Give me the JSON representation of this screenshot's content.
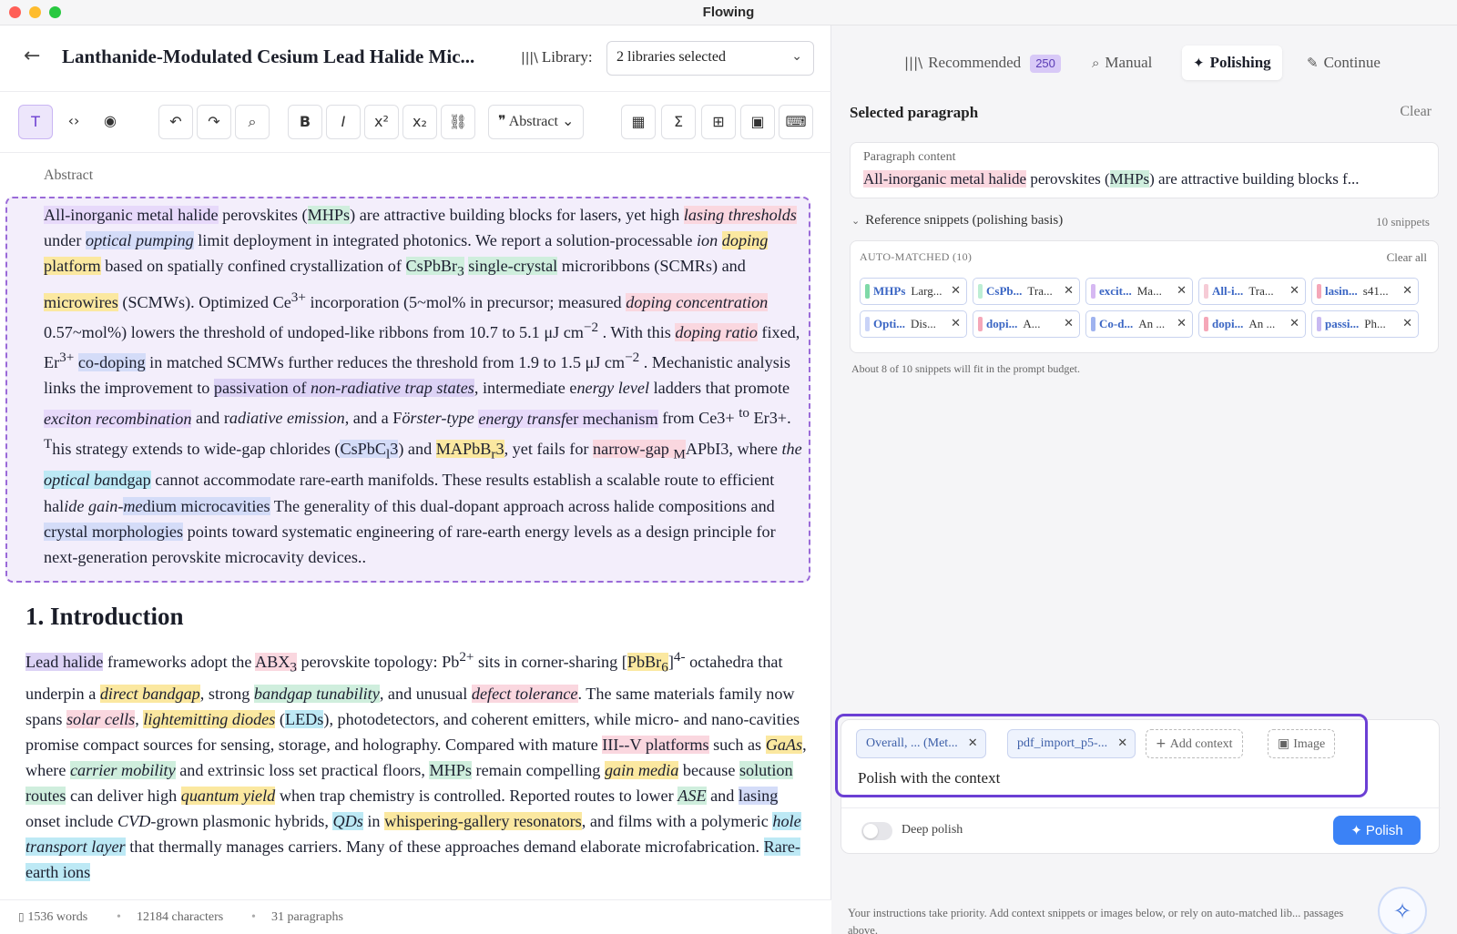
{
  "window": {
    "title": "Flowing"
  },
  "doc": {
    "title": "Lanthanide-Modulated Cesium Lead Halide Mic...",
    "library_label": "Library:",
    "library_value": "2 libraries selected",
    "section_label": "Abstract",
    "heading": "1. Introduction"
  },
  "toolbar": {
    "abstract_label": "Abstract"
  },
  "status": {
    "words": "1536 words",
    "characters": "12184 characters",
    "paragraphs": "31 paragraphs"
  },
  "panel": {
    "tabs": [
      {
        "label": "Recommended",
        "icon": "library-icon",
        "badge": "250"
      },
      {
        "label": "Manual",
        "icon": "search-icon"
      },
      {
        "label": "Polishing",
        "icon": "sparkle-icon"
      },
      {
        "label": "Continue",
        "icon": "pen-icon"
      }
    ],
    "selected_title": "Selected paragraph",
    "clear": "Clear",
    "paragraph_label": "Paragraph content",
    "paragraph_lead": "All-inorganic metal halide",
    "paragraph_mid": " perovskites (",
    "paragraph_abbr": "MHPs",
    "paragraph_tail": ") are attractive building blocks f...",
    "ref_title": "Reference snippets (polishing basis)",
    "ref_count": "10 snippets",
    "auto_label": "AUTO-MATCHED (10)",
    "clear_all": "Clear all",
    "snippets": [
      {
        "label": "MHPs",
        "desc": "Larg...",
        "color": "#7fd9a8"
      },
      {
        "label": "CsPb...",
        "desc": "Tra...",
        "color": "#bdeed4"
      },
      {
        "label": "excit...",
        "desc": "Ma...",
        "color": "#d6b8f2"
      },
      {
        "label": "All-i...",
        "desc": "Tra...",
        "color": "#f6cbd6"
      },
      {
        "label": "lasin...",
        "desc": "s41...",
        "color": "#f5a7b8"
      },
      {
        "label": "Opti...",
        "desc": "Dis...",
        "color": "#c9d3f7"
      },
      {
        "label": "dopi...",
        "desc": "A...",
        "color": "#f5a7b8"
      },
      {
        "label": "Co-d...",
        "desc": "An ...",
        "color": "#9fb3ef"
      },
      {
        "label": "dopi...",
        "desc": "An ...",
        "color": "#f5a7b8"
      },
      {
        "label": "passi...",
        "desc": "Ph...",
        "color": "#c8b9f2"
      }
    ],
    "budget": "About 8 of 10 snippets will fit in the prompt budget.",
    "compose": {
      "ctx1": "Overall, ... (Met...",
      "ctx2": "pdf_import_p5-...",
      "add_context": "Add context",
      "image": "Image",
      "prompt": "Polish with the context",
      "deep": "Deep polish",
      "polish": "Polish"
    },
    "help": "Your instructions take priority. Add context snippets or images below, or rely on auto-matched lib... passages above."
  }
}
